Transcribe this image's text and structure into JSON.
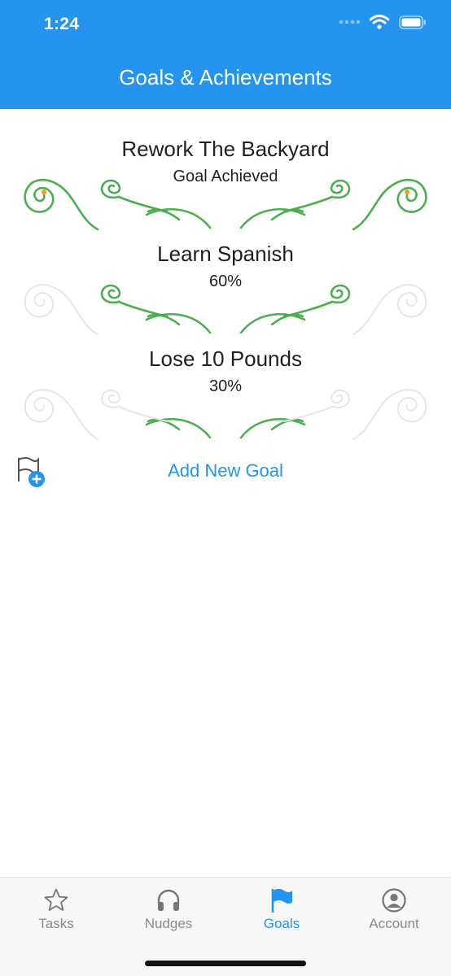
{
  "status_bar": {
    "time": "1:24"
  },
  "header": {
    "title": "Goals & Achievements"
  },
  "colors": {
    "accent": "#2594ee",
    "progress_green": "#4cae4f",
    "ornament_gray": "#e6e6e6",
    "achieved_dot": "#f0a020"
  },
  "goals": [
    {
      "title": "Rework The Backyard",
      "status": "Goal Achieved",
      "progress": 1.0
    },
    {
      "title": "Learn Spanish",
      "status": "60%",
      "progress": 0.6
    },
    {
      "title": "Lose 10 Pounds",
      "status": "30%",
      "progress": 0.3
    }
  ],
  "add_goal": {
    "label": "Add New Goal",
    "icon": "flag-plus-icon"
  },
  "tabs": [
    {
      "label": "Tasks",
      "icon": "star-icon",
      "active": false
    },
    {
      "label": "Nudges",
      "icon": "headphones-icon",
      "active": false
    },
    {
      "label": "Goals",
      "icon": "flag-icon",
      "active": true
    },
    {
      "label": "Account",
      "icon": "account-circle-icon",
      "active": false
    }
  ]
}
